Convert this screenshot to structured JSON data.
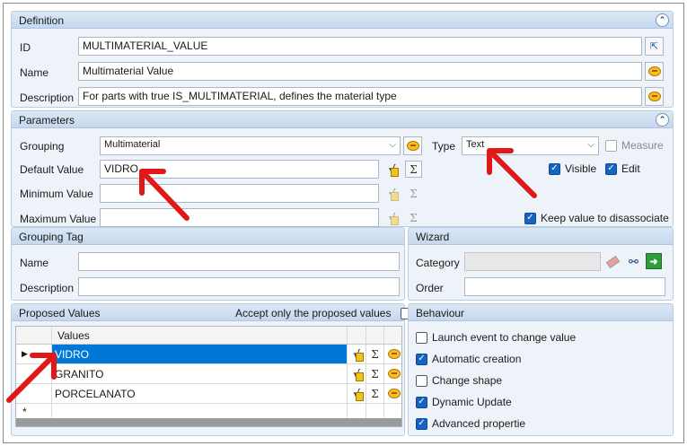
{
  "definition": {
    "title": "Definition",
    "id_label": "ID",
    "id_value": "MULTIMATERIAL_VALUE",
    "name_label": "Name",
    "name_value": "Multimaterial Value",
    "description_label": "Description",
    "description_value": "For parts with true IS_MULTIMATERIAL, defines the material type"
  },
  "parameters": {
    "title": "Parameters",
    "grouping_label": "Grouping",
    "grouping_value": "Multimaterial",
    "type_label": "Type",
    "type_value": "Text",
    "measure_label": "Measure",
    "default_label": "Default Value",
    "default_value": "VIDRO",
    "min_label": "Minimum Value",
    "max_label": "Maximum Value",
    "visible_label": "Visible",
    "edit_label": "Edit",
    "keep_label": "Keep value to disassociate",
    "sigma": "Σ"
  },
  "grouping_tag": {
    "title": "Grouping Tag",
    "name_label": "Name",
    "description_label": "Description"
  },
  "wizard": {
    "title": "Wizard",
    "category_label": "Category",
    "order_label": "Order"
  },
  "proposed": {
    "title": "Proposed Values",
    "accept_label": "Accept only the proposed values",
    "column_header": "Values",
    "rows": [
      "VIDRO",
      "GRANITO",
      "PORCELANATO"
    ],
    "new_row_marker": "*",
    "sigma": "Σ"
  },
  "behaviour": {
    "title": "Behaviour",
    "items": [
      {
        "label": "Launch event to change value",
        "checked": false
      },
      {
        "label": "Automatic creation",
        "checked": true
      },
      {
        "label": "Change shape",
        "checked": false
      },
      {
        "label": "Dynamic Update",
        "checked": true
      },
      {
        "label": "Advanced propertie",
        "checked": true
      }
    ]
  },
  "colors": {
    "accent": "#0078d7",
    "annotation_arrow": "#e01818",
    "group_background": "#eef3f9"
  }
}
